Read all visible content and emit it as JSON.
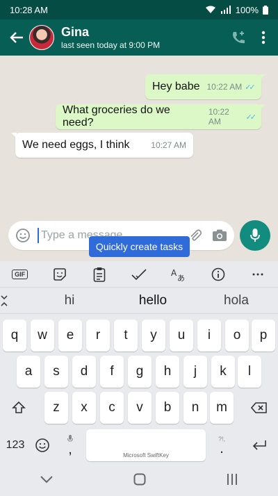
{
  "status": {
    "time": "10:28 AM",
    "battery": "100%"
  },
  "header": {
    "name": "Gina",
    "status": "last seen today at 9:00 PM"
  },
  "messages": [
    {
      "text": "Hey babe",
      "time": "10:22 AM",
      "direction": "out"
    },
    {
      "text": "What groceries do we need?",
      "time": "10:22 AM",
      "direction": "out"
    },
    {
      "text": "We need eggs, I think",
      "time": "10:27 AM",
      "direction": "in"
    }
  ],
  "composer": {
    "placeholder": "Type a message",
    "value": ""
  },
  "tooltip": "Quickly create tasks",
  "keyboard": {
    "suggestions": [
      "hi",
      "hello",
      "hola"
    ],
    "row1": [
      "q",
      "w",
      "e",
      "r",
      "t",
      "y",
      "u",
      "i",
      "o",
      "p"
    ],
    "row2": [
      "a",
      "s",
      "d",
      "f",
      "g",
      "h",
      "j",
      "k",
      "l"
    ],
    "row3": [
      "z",
      "x",
      "c",
      "v",
      "b",
      "n",
      "m"
    ],
    "numbers_key": "123",
    "comma_key": ",",
    "period_key": ".",
    "punct_hint": "?!,",
    "space_brand": "Microsoft SwiftKey",
    "toolbar": {
      "gif": "GIF"
    }
  },
  "colors": {
    "header": "#075e54",
    "status_bar": "#054d44",
    "outgoing": "#dcf8c6",
    "accent": "#128c7e",
    "tooltip": "#2f6bd9"
  }
}
